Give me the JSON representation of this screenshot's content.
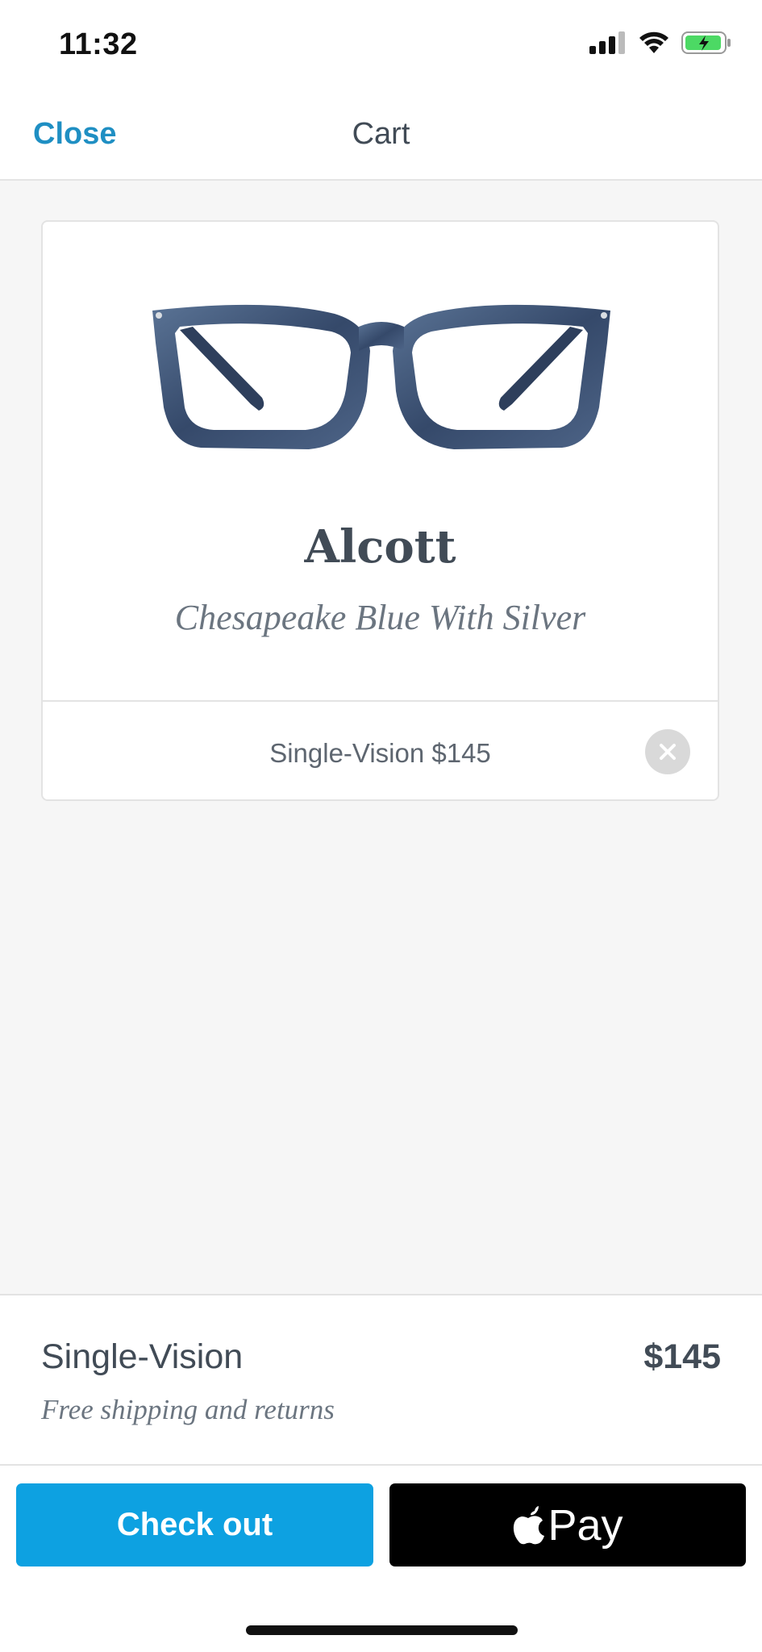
{
  "status_bar": {
    "time": "11:32"
  },
  "nav": {
    "close_label": "Close",
    "title": "Cart"
  },
  "product": {
    "name": "Alcott",
    "color": "Chesapeake Blue With Silver",
    "line_item": "Single-Vision $145",
    "frame_color": "#3d5576"
  },
  "summary": {
    "label": "Single-Vision",
    "price": "$145",
    "shipping": "Free shipping and returns"
  },
  "actions": {
    "checkout_label": "Check out",
    "applepay_label": "Pay"
  },
  "colors": {
    "accent": "#1f8fc3",
    "checkout_bg": "#0da1e1",
    "applepay_bg": "#000000"
  }
}
